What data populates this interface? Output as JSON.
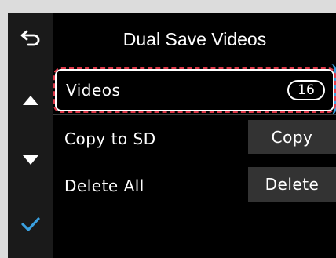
{
  "screen": {
    "title": "Dual Save Videos"
  },
  "sidebar": {
    "back_icon": "back-arrow-icon",
    "up_icon": "triangle-up-icon",
    "down_icon": "triangle-down-icon",
    "confirm_icon": "checkmark-icon",
    "confirm_color": "#3aa0e0"
  },
  "rows": {
    "videos": {
      "label": "Videos",
      "count": "16",
      "selected": true
    },
    "copy": {
      "label": "Copy to SD",
      "button": "Copy"
    },
    "delete": {
      "label": "Delete All",
      "button": "Delete"
    }
  },
  "colors": {
    "background": "#000000",
    "sidebar": "#1a1a1a",
    "button": "#333333",
    "selection_border": "#e0394a",
    "accent": "#3aa0e0"
  }
}
